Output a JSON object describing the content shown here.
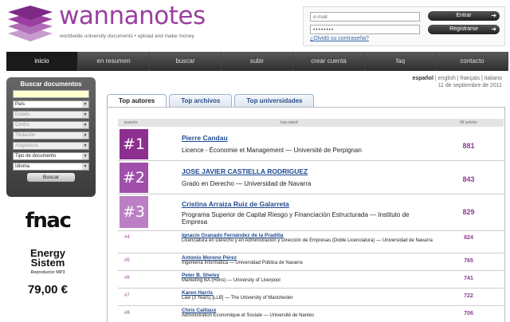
{
  "header": {
    "brand": "wannanotes",
    "tagline": "worldwide university documents • upload and make money",
    "email_placeholder": "e-mail",
    "password_value": "••••••••",
    "forgot_label": "¿Olvidó su contraseña?",
    "login_label": "Entrar",
    "register_label": "Registrarse",
    "arrow": "➜"
  },
  "nav": [
    "inicio",
    "en resumen",
    "buscar",
    "subir",
    "crear cuenta",
    "faq",
    "contacto"
  ],
  "search": {
    "title": "Buscar documentos",
    "selects": [
      {
        "label": "País",
        "enabled": true
      },
      {
        "label": "Estado",
        "enabled": false
      },
      {
        "label": "Centro",
        "enabled": false
      },
      {
        "label": "Titulación",
        "enabled": false
      },
      {
        "label": "Asignatura",
        "enabled": false
      },
      {
        "label": "Tipo de documento",
        "enabled": true
      },
      {
        "label": "Idioma",
        "enabled": true
      }
    ],
    "button": "Buscar"
  },
  "ad": {
    "brand": "fnac",
    "product_line1": "Energy",
    "product_line2": "Sistem",
    "product_sub": "Reproductor MP3",
    "price": "79,00 €"
  },
  "languages": {
    "current": "español",
    "others": [
      "english",
      "français",
      "italiano"
    ],
    "separator": " | "
  },
  "date": "11 de septiembre de 2011",
  "tabs": [
    "Top autores",
    "Top archivos",
    "Top universidades"
  ],
  "table": {
    "col_rank": "puesto",
    "col_name": "top rated",
    "col_points": "W points"
  },
  "colors": {
    "brand_purple": "#9a3fa0",
    "badge1": "#8c2f90",
    "badge2": "#a04fab",
    "badge3": "#bd7fc4"
  },
  "rows": [
    {
      "rank": "#1",
      "name": "Pierre Candau",
      "desc": "Licence - Économie et Management — Université de Perpignan",
      "points": "881"
    },
    {
      "rank": "#2",
      "name": "JOSE JAVIER CASTIELLA RODRIGUEZ",
      "desc": "Grado en Derecho — Universidad de Navarra",
      "points": "843"
    },
    {
      "rank": "#3",
      "name": "Cristina Arraiza Ruiz de Galarreta",
      "desc": "Programa Superior de Capital Riesgo y Financiación Estructurada — Instituto de Empresa",
      "points": "829"
    },
    {
      "rank": "#4",
      "name": "Ignacio Granado Fernández de la Pradilla",
      "desc": "Licenciatura en Derecho y en Administración y Dirección de Empresas (Doble Licenciatura) — Universidad de Navarra",
      "points": "824"
    },
    {
      "rank": "#5",
      "name": "Antonio Moreno Pérez",
      "desc": "Ingeniería Informática — Universidad Pública de Navarra",
      "points": "765"
    },
    {
      "rank": "#6",
      "name": "Peter B. Sheley",
      "desc": "Marketing BA (Hons) — University of Liverpool",
      "points": "741"
    },
    {
      "rank": "#7",
      "name": "Karen Harris",
      "desc": "Law (3 Years) [LLB] — The University of Manchester",
      "points": "722"
    },
    {
      "rank": "#8",
      "name": "Chris Caillaux",
      "desc": "Administration Économique et Sociale — Université de Nantes",
      "points": "706"
    }
  ]
}
